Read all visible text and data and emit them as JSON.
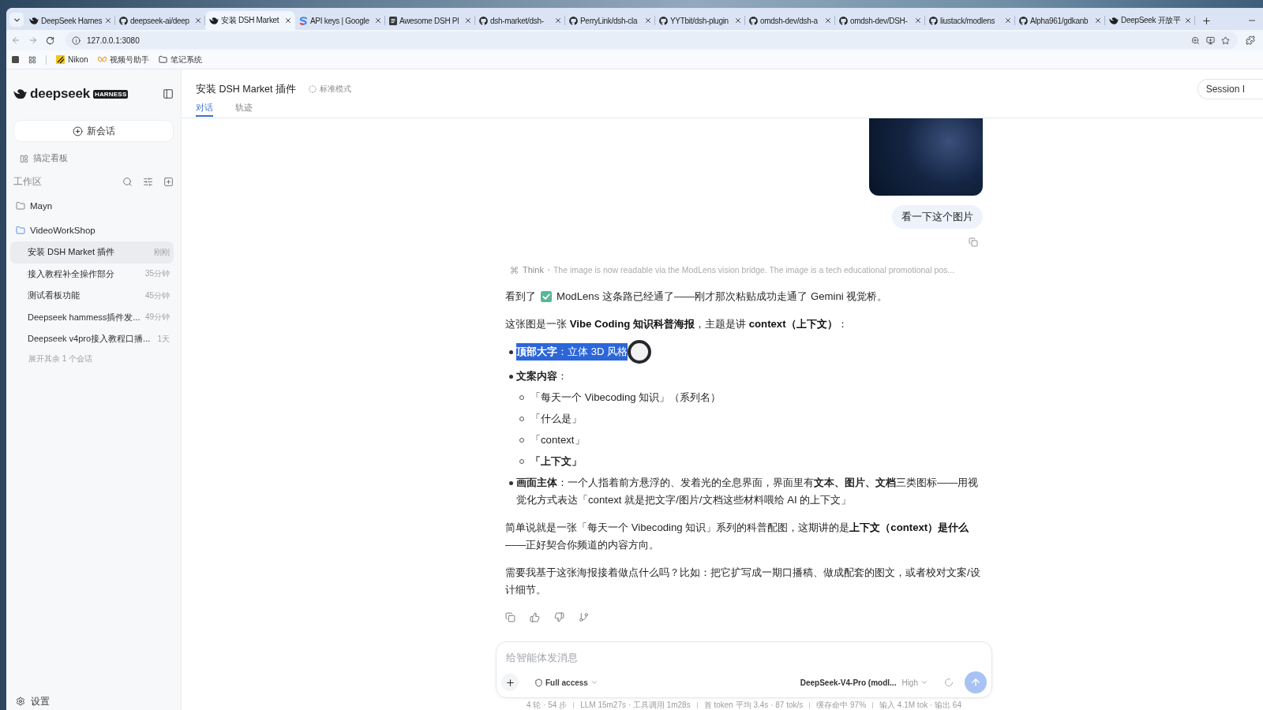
{
  "browser": {
    "tabs": [
      {
        "title": "DeepSeek Harnes",
        "kind": "deepseek",
        "selected": false
      },
      {
        "title": "deepseek-ai/deep",
        "kind": "github",
        "selected": false
      },
      {
        "title": "安装 DSH Market",
        "kind": "deepseek",
        "selected": true
      },
      {
        "title": "API keys | Google",
        "kind": "studio",
        "selected": false
      },
      {
        "title": "Awesome DSH Pl",
        "kind": "doc",
        "selected": false
      },
      {
        "title": "dsh-market/dsh-",
        "kind": "github",
        "selected": false
      },
      {
        "title": "PerryLink/dsh-cla",
        "kind": "github",
        "selected": false
      },
      {
        "title": "YYTbit/dsh-plugin",
        "kind": "github",
        "selected": false
      },
      {
        "title": "omdsh-dev/dsh-a",
        "kind": "github",
        "selected": false
      },
      {
        "title": "omdsh-dev/DSH-",
        "kind": "github",
        "selected": false
      },
      {
        "title": "liustack/modlens",
        "kind": "github",
        "selected": false
      },
      {
        "title": "Alpha961/gdkanb",
        "kind": "github",
        "selected": false
      },
      {
        "title": "DeepSeek 开放平",
        "kind": "deepseek",
        "selected": false
      }
    ],
    "address": "127.0.0.1:3080",
    "bookmarks": [
      {
        "label": "Nikon",
        "kind": "stripes"
      },
      {
        "label": "视频号助手",
        "kind": "butterfly"
      },
      {
        "label": "笔记系统",
        "kind": "folder"
      }
    ]
  },
  "sidebar": {
    "brand": "deepseek",
    "badge": "HARNESS",
    "new_chat": "新会话",
    "board": "搞定看板",
    "workspace": "工作区",
    "folders": [
      {
        "name": "Mayn",
        "expanded": false
      },
      {
        "name": "VideoWorkShop",
        "expanded": true,
        "children": [
          {
            "title": "安装 DSH Market 插件",
            "time": "刚刚",
            "selected": true
          },
          {
            "title": "接入教程补全操作部分",
            "time": "35分钟",
            "selected": false
          },
          {
            "title": "测试看板功能",
            "time": "45分钟",
            "selected": false
          },
          {
            "title": "Deepseek hammess插件发...",
            "time": "49分钟",
            "selected": false
          },
          {
            "title": "Deepseek v4pro接入教程口播...",
            "time": "1天",
            "selected": false
          }
        ]
      }
    ],
    "more": "展开其余 1 个会话",
    "settings": "设置"
  },
  "conversation": {
    "title": "安装 DSH Market 插件",
    "mode": "标准模式",
    "tabs": [
      {
        "label": "对话",
        "selected": true
      },
      {
        "label": "轨迹",
        "selected": false
      }
    ],
    "session_button": "Session I"
  },
  "user_message": {
    "attachments": [
      {
        "kind": "image"
      }
    ],
    "text": "看一下这个图片"
  },
  "assistant_message": {
    "think_label": "Think",
    "think_summary": "The image is now readable via the ModLens vision bridge. The image is a tech educational promotional pos...",
    "blocks": [
      {
        "kind": "check_note",
        "lead": "看到了",
        "text": "ModLens 这条路已经通了——刚才那次粘贴成功走通了 Gemini 视觉桥。"
      },
      {
        "kind": "paragraph",
        "text": "这张图是一张 **Vibe Coding 知识科普海报**，主题是讲 **context（上下文）**："
      },
      {
        "kind": "list",
        "items": [
          {
            "text": "**顶部大字**：立体 3D 风格",
            "highlighted": true
          },
          {
            "text": "**文案内容**：",
            "highlighted": false,
            "children": [
              {
                "text": "「每天一个 Vibecoding 知识」（系列名）",
                "strong": false
              },
              {
                "text": "「什么是」",
                "strong": false
              },
              {
                "text": "「context」",
                "strong": false
              },
              {
                "text": "「上下文」",
                "strong": true
              }
            ]
          },
          {
            "text": "**画面主体**：一个人指着前方悬浮的、发着光的全息界面，界面里有**文本、图片、文档**三类图标——用视觉化方式表达「context 就是把文字/图片/文档这些材料喂给 AI 的上下文」",
            "highlighted": false
          }
        ]
      },
      {
        "kind": "paragraph",
        "text": "简单说就是一张「每天一个 Vibecoding 知识」系列的科普配图，这期讲的是**上下文（context）是什么**——正好契合你频道的内容方向。"
      },
      {
        "kind": "paragraph",
        "text": "需要我基于这张海报接着做点什么吗？比如：把它扩写成一期口播稿、做成配套的图文，或者校对文案/设计细节。"
      }
    ]
  },
  "composer": {
    "placeholder": "给智能体发消息",
    "access": "Full access",
    "model": "DeepSeek-V4-Pro (modl...",
    "effort": "High"
  },
  "status_bar": [
    "4 轮 · 54 步",
    "LLM 15m27s · 工具调用 1m28s",
    "首 token 平均 3.4s · 87 tok/s",
    "缓存命中 97%",
    "输入 4.1M tok · 输出 64"
  ]
}
